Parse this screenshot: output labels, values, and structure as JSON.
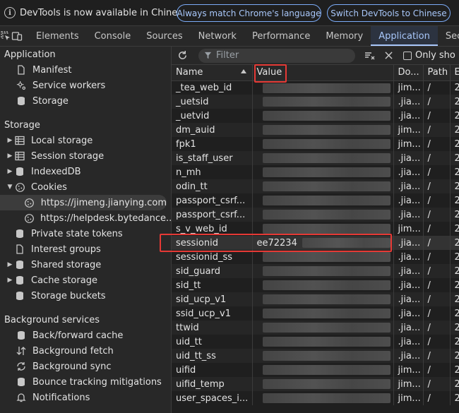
{
  "infobar": {
    "message": "DevTools is now available in Chinese!",
    "btn_match": "Always match Chrome's language",
    "btn_switch": "Switch DevTools to Chinese"
  },
  "tabs": [
    "Elements",
    "Console",
    "Sources",
    "Network",
    "Performance",
    "Memory",
    "Application",
    "Secu"
  ],
  "active_tab": "Application",
  "sidebar": {
    "application_title": "Application",
    "application_items": [
      {
        "label": "Manifest",
        "icon": "file-icon"
      },
      {
        "label": "Service workers",
        "icon": "gear-icon"
      },
      {
        "label": "Storage",
        "icon": "database-icon"
      }
    ],
    "storage_title": "Storage",
    "storage_items": [
      {
        "label": "Local storage",
        "icon": "table-icon",
        "arrow": "▶"
      },
      {
        "label": "Session storage",
        "icon": "table-icon",
        "arrow": "▶"
      },
      {
        "label": "IndexedDB",
        "icon": "database-icon",
        "arrow": "▶"
      },
      {
        "label": "Cookies",
        "icon": "cookie-icon",
        "arrow": "▼"
      }
    ],
    "cookie_children": [
      {
        "label": "https://jimeng.jianying.com",
        "selected": true
      },
      {
        "label": "https://helpdesk.bytedance...",
        "selected": false
      }
    ],
    "storage_items_2": [
      {
        "label": "Private state tokens",
        "icon": "database-icon",
        "arrow": ""
      },
      {
        "label": "Interest groups",
        "icon": "file-icon",
        "arrow": ""
      },
      {
        "label": "Shared storage",
        "icon": "database-icon",
        "arrow": "▶"
      },
      {
        "label": "Cache storage",
        "icon": "database-icon",
        "arrow": "▶"
      },
      {
        "label": "Storage buckets",
        "icon": "database-icon",
        "arrow": ""
      }
    ],
    "bg_title": "Background services",
    "bg_items": [
      {
        "label": "Back/forward cache",
        "icon": "database-icon"
      },
      {
        "label": "Background fetch",
        "icon": "swap-icon"
      },
      {
        "label": "Background sync",
        "icon": "sync-icon"
      },
      {
        "label": "Bounce tracking mitigations",
        "icon": "database-icon"
      },
      {
        "label": "Notifications",
        "icon": "bell-icon"
      }
    ]
  },
  "toolbar": {
    "filter_placeholder": "Filter",
    "only_show": "Only sho"
  },
  "table": {
    "headers": [
      "Name",
      "Value",
      "Do...",
      "Path",
      "E"
    ],
    "rows": [
      {
        "name": "_tea_web_id",
        "value": "",
        "domain": "jim...",
        "path": "/",
        "e": "2"
      },
      {
        "name": "_uetsid",
        "value": "",
        "domain": ".jia...",
        "path": "/",
        "e": "2"
      },
      {
        "name": "_uetvid",
        "value": "",
        "domain": ".jia...",
        "path": "/",
        "e": "2"
      },
      {
        "name": "dm_auid",
        "value": "",
        "domain": "jim...",
        "path": "/",
        "e": "2"
      },
      {
        "name": "fpk1",
        "value": "",
        "domain": "jim...",
        "path": "/",
        "e": "2"
      },
      {
        "name": "is_staff_user",
        "value": "",
        "domain": ".jia...",
        "path": "/",
        "e": "2"
      },
      {
        "name": "n_mh",
        "value": "",
        "domain": ".jia...",
        "path": "/",
        "e": "2"
      },
      {
        "name": "odin_tt",
        "value": "",
        "domain": ".jia...",
        "path": "/",
        "e": "2"
      },
      {
        "name": "passport_csrf...",
        "value": "",
        "domain": ".jia...",
        "path": "/",
        "e": "2"
      },
      {
        "name": "passport_csrf...",
        "value": "",
        "domain": ".jia...",
        "path": "/",
        "e": "2"
      },
      {
        "name": "s_v_web_id",
        "value": "",
        "domain": "jim...",
        "path": "/",
        "e": "2"
      },
      {
        "name": "sessionid",
        "value": "ee72234",
        "domain": ".jia...",
        "path": "/",
        "e": "2"
      },
      {
        "name": "sessionid_ss",
        "value": "",
        "domain": ".jia...",
        "path": "/",
        "e": "2"
      },
      {
        "name": "sid_guard",
        "value": "",
        "domain": ".jia...",
        "path": "/",
        "e": "2"
      },
      {
        "name": "sid_tt",
        "value": "",
        "domain": ".jia...",
        "path": "/",
        "e": "2"
      },
      {
        "name": "sid_ucp_v1",
        "value": "",
        "domain": ".jia...",
        "path": "/",
        "e": "2"
      },
      {
        "name": "ssid_ucp_v1",
        "value": "",
        "domain": ".jia...",
        "path": "/",
        "e": "2"
      },
      {
        "name": "ttwid",
        "value": "",
        "domain": ".jia...",
        "path": "/",
        "e": "2"
      },
      {
        "name": "uid_tt",
        "value": "",
        "domain": ".jia...",
        "path": "/",
        "e": "2"
      },
      {
        "name": "uid_tt_ss",
        "value": "",
        "domain": ".jia...",
        "path": "/",
        "e": "2"
      },
      {
        "name": "uifid",
        "value": "",
        "domain": "jim...",
        "path": "/",
        "e": "2"
      },
      {
        "name": "uifid_temp",
        "value": "",
        "domain": "jim...",
        "path": "/",
        "e": "2"
      },
      {
        "name": "user_spaces_i...",
        "value": "",
        "domain": "jim...",
        "path": "/",
        "e": "2"
      }
    ],
    "highlight_row": 11
  },
  "colors": {
    "accent": "#a8c7fa",
    "annotation": "#e53935"
  }
}
